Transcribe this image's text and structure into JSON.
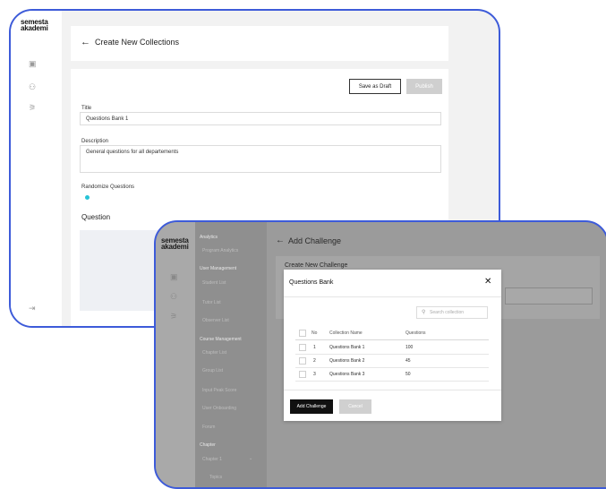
{
  "back": {
    "logo": "semesta akademi",
    "page_title": "Create New Collections",
    "save_draft_label": "Save as Draft",
    "publish_label": "Publish",
    "title_label": "Title",
    "title_value": "Questions Bank 1",
    "description_label": "Description",
    "description_value": "General questions for all departements",
    "randomize_label": "Randomize Questions",
    "question_label": "Question"
  },
  "front": {
    "logo": "semesta akademi",
    "page_title": "Add Challenge",
    "under_title": "Create New Challenge",
    "nav": {
      "analytics_head": "Analytics",
      "program_analytics": "Program Analytics",
      "user_mgmt_head": "User Management",
      "student_list": "Student List",
      "tutor_list": "Tutor List",
      "observer_list": "Observer List",
      "course_mgmt_head": "Course Management",
      "chapter_list": "Chapter List",
      "group_list": "Group List",
      "input_peak_score": "Input Peak Score",
      "user_onboarding": "User Onboarding",
      "forum": "Forum",
      "chapter_head": "Chapter",
      "chapter_1": "Chapter 1",
      "topics": "Topics"
    },
    "modal": {
      "title": "Questions Bank",
      "search_placeholder": "Search collection",
      "headers": {
        "no": "No",
        "name": "Collection Name",
        "questions": "Questions"
      },
      "rows": [
        {
          "no": "1",
          "name": "Questions Bank 1",
          "questions": "100"
        },
        {
          "no": "2",
          "name": "Questions Bank 2",
          "questions": "45"
        },
        {
          "no": "3",
          "name": "Questions Bank 3",
          "questions": "50"
        }
      ],
      "add_label": "Add Challenge",
      "cancel_label": "Cancel"
    }
  },
  "colors": {
    "frame": "#3d5bd9",
    "accent_dot": "#27c3d6",
    "primary_button": "#111111"
  },
  "icons": [
    "book-icon",
    "users-icon",
    "org-icon",
    "logout-icon",
    "back-arrow-icon",
    "close-icon",
    "search-icon",
    "chevron-down-icon"
  ]
}
